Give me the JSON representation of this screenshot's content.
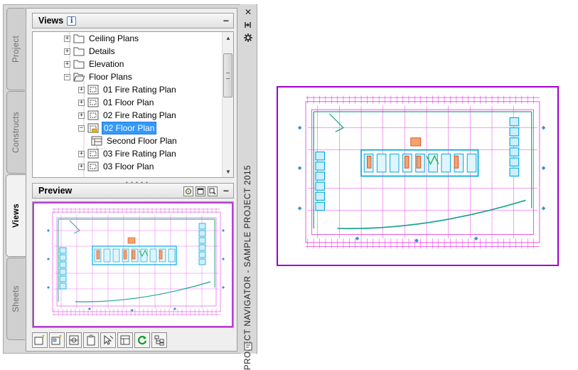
{
  "palette": {
    "title": "PROJECT NAVIGATOR - SAMPLE PROJECT 2015",
    "tabs": [
      {
        "label": "Project"
      },
      {
        "label": "Constructs"
      },
      {
        "label": "Views"
      },
      {
        "label": "Sheets"
      }
    ],
    "active_tab": "Views",
    "strip_icons": {
      "close": "close-icon",
      "autohide": "auto-hide-icon",
      "properties": "properties-icon",
      "bottom": "palette-menu-icon"
    }
  },
  "views_section": {
    "title": "Views",
    "info_icon": "i",
    "collapse": "−"
  },
  "tree": {
    "items": [
      {
        "label": "Ceiling Plans",
        "icon": "folder-icon",
        "expander": "+",
        "level": 1
      },
      {
        "label": "Details",
        "icon": "folder-icon",
        "expander": "+",
        "level": 1
      },
      {
        "label": "Elevation",
        "icon": "folder-icon",
        "expander": "+",
        "level": 1
      },
      {
        "label": "Floor Plans",
        "icon": "open-folder-icon",
        "expander": "−",
        "level": 1
      },
      {
        "label": "01 Fire Rating Plan",
        "icon": "view-drawing-icon",
        "expander": "+",
        "level": 2
      },
      {
        "label": "01 Floor Plan",
        "icon": "view-drawing-icon",
        "expander": "+",
        "level": 2
      },
      {
        "label": "02 Fire Rating Plan",
        "icon": "view-drawing-icon",
        "expander": "+",
        "level": 2
      },
      {
        "label": "02 Floor Plan",
        "icon": "locked-view-drawing-icon",
        "expander": "−",
        "level": 2,
        "selected": true
      },
      {
        "label": "Second Floor Plan",
        "icon": "model-space-view-icon",
        "expander": "",
        "level": 3
      },
      {
        "label": "03 Fire Rating Plan",
        "icon": "view-drawing-icon",
        "expander": "+",
        "level": 2
      },
      {
        "label": "03 Floor Plan",
        "icon": "view-drawing-icon",
        "expander": "+",
        "level": 2
      }
    ]
  },
  "preview_section": {
    "title": "Preview",
    "collapse": "−",
    "tools": [
      "preview-toggle-icon",
      "preview-window-icon",
      "zoom-preview-icon"
    ]
  },
  "toolbar": {
    "buttons": [
      "add-view-icon",
      "add-detail-view-icon",
      "add-section-view-icon",
      "clipboard-icon",
      "select-cursor-icon",
      "view-properties-icon",
      "refresh-icon",
      "repath-project-icon"
    ]
  },
  "colors": {
    "drawing_border": "#a100c9",
    "plan_magenta": "#e43be6",
    "plan_cyan": "#00a8d8",
    "plan_teal": "#1aa58a",
    "selection": "#3399ff"
  }
}
